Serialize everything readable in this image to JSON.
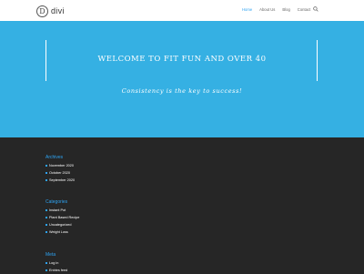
{
  "header": {
    "logo_mark": "D",
    "logo_text": "divi",
    "nav": [
      "Home",
      "About Us",
      "Blog",
      "Contact"
    ],
    "active_nav": "Home",
    "search_icon": "search-icon"
  },
  "hero": {
    "title": "WELCOME TO FIT FUN AND OVER 40",
    "subtitle": "Consistency is the key to success!"
  },
  "footer": {
    "archives": {
      "title": "Archives",
      "items": [
        "November 2020",
        "October 2020",
        "September 2020"
      ]
    },
    "categories": {
      "title": "Categories",
      "items": [
        "Instant Pot",
        "Plant Based Recipe",
        "Uncategorized",
        "Weight Loss"
      ]
    },
    "meta": {
      "title": "Meta",
      "items": [
        "Log in",
        "Entries feed"
      ]
    }
  },
  "colors": {
    "accent": "#2ea3f2",
    "hero_bg": "#35b0e3",
    "footer_bg": "#262626"
  }
}
